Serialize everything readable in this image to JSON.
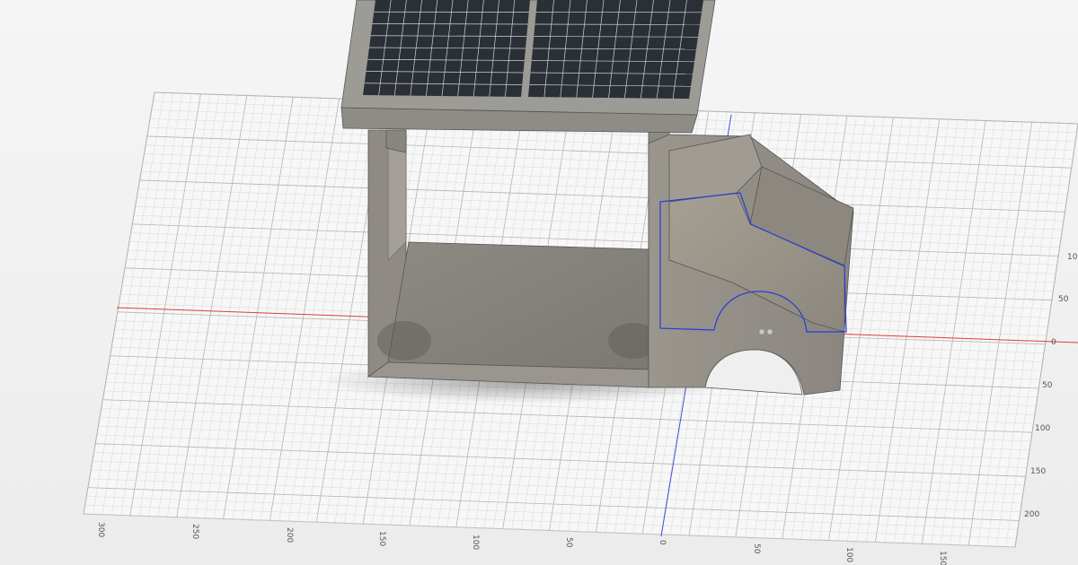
{
  "viewport": {
    "background": "#f1f1f1",
    "grid_color": "#cfcfcf",
    "major_grid_color": "#b4b4b4",
    "x_axis_color": "#e23b3b",
    "y_axis_color": "#3f4fe0",
    "sketch_color": "#2a3cd6"
  },
  "axis_labels": {
    "bottom": [
      "300",
      "250",
      "200",
      "150",
      "100",
      "50",
      "0",
      "50",
      "100",
      "150"
    ],
    "right": [
      "10",
      "50",
      "0",
      "50",
      "100",
      "150",
      "200"
    ]
  },
  "model": {
    "name": "solar-cart",
    "body_color": "#9b978f",
    "panel_color": "#2b2f36",
    "frame_color": "#8e8c86"
  }
}
